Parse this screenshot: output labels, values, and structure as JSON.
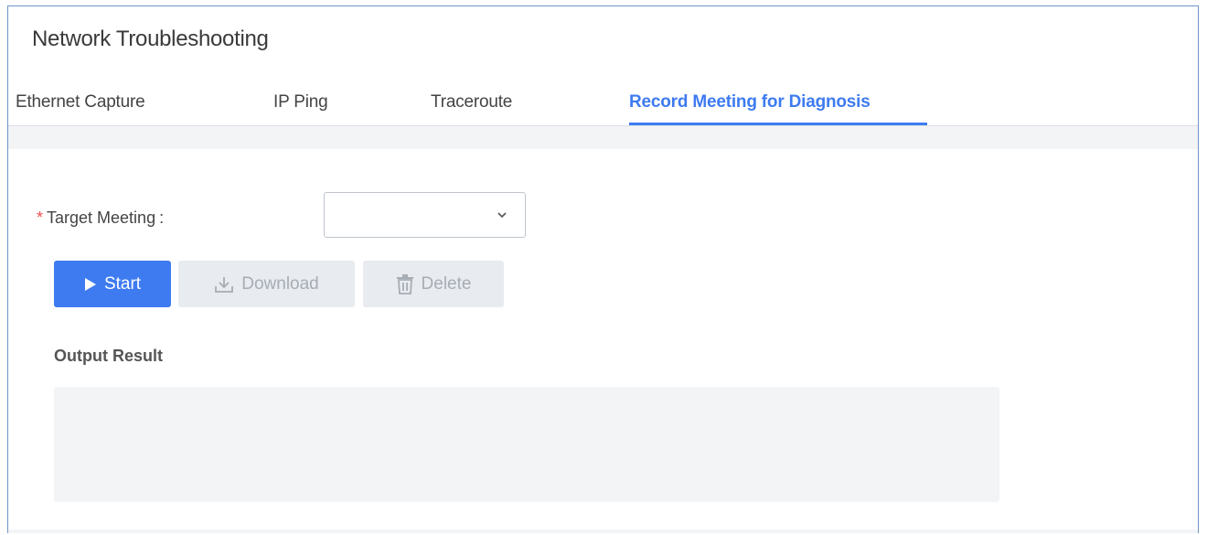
{
  "page": {
    "title": "Network Troubleshooting"
  },
  "tabs": [
    {
      "label": "Ethernet Capture",
      "active": false
    },
    {
      "label": "IP Ping",
      "active": false
    },
    {
      "label": "Traceroute",
      "active": false
    },
    {
      "label": "Record Meeting for Diagnosis",
      "active": true
    }
  ],
  "form": {
    "target_meeting": {
      "required_mark": "*",
      "label": "Target Meeting",
      "colon": ":",
      "value": "",
      "icon": "chevron-down-icon"
    }
  },
  "actions": {
    "start": {
      "label": "Start",
      "icon": "play-icon",
      "enabled": true
    },
    "download": {
      "label": "Download",
      "icon": "download-icon",
      "enabled": false
    },
    "delete": {
      "label": "Delete",
      "icon": "trash-icon",
      "enabled": false
    }
  },
  "output": {
    "label": "Output Result",
    "value": ""
  },
  "colors": {
    "accent": "#3e7bf0",
    "required": "#f0504d",
    "disabled_bg": "#e8ebef",
    "disabled_text": "#a7adb5",
    "panel_bg": "#f3f4f6"
  }
}
